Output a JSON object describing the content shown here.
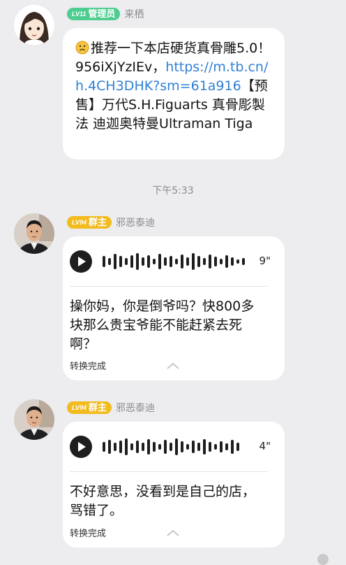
{
  "messages": [
    {
      "badge_level": "LV11",
      "badge_role": "管理员",
      "badge_color": "#4fcc90",
      "sender": "来栖",
      "avatar": "cartoon-girl-avatar",
      "emoji": "worried-face-emoji",
      "text_before_link": "推荐一下本店硬货真骨雕5.0！956iXjYzIEv，",
      "link": "https://m.tb.cn/h.4CH3DHK?sm=61a916",
      "text_after_link": "【预售】万代S.H.Figuarts 真骨彫製法 迪迦奥特曼Ultraman Tiga"
    },
    {
      "badge_level": "LV94",
      "badge_role": "群主",
      "badge_color": "#f2bb1e",
      "sender": "邪恶泰迪",
      "avatar": "man-photo-avatar",
      "voice_duration": "9\"",
      "transcript": "操你妈，你是倒爷吗？快800多块那么贵宝爷能不能赶紧去死啊？",
      "status": "转换完成"
    },
    {
      "badge_level": "LV94",
      "badge_role": "群主",
      "badge_color": "#f2bb1e",
      "sender": "邪恶泰迪",
      "avatar": "man-photo-avatar",
      "voice_duration": "4\"",
      "transcript": "不好意思，没看到是自己的店，骂错了。",
      "status": "转换完成"
    }
  ],
  "timestamp": "下午5:33"
}
